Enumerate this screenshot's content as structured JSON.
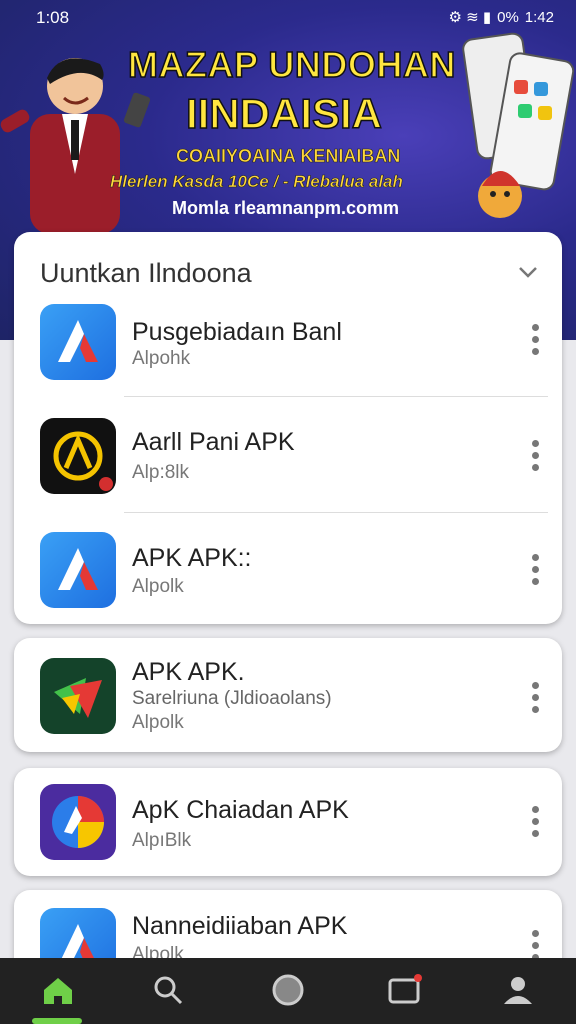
{
  "status_bar": {
    "time": "1:08",
    "right": "1:42",
    "battery": "0%"
  },
  "banner": {
    "title_line1": "MAZAP UNDOHAN",
    "title_line2": "IINDAISIA",
    "subtitle1": "COAIIYOAINA KENIAIBAN",
    "subtitle2": "Hlerlen Kasda 10Ce / - RIebalua alah",
    "url": "Momla rleamnanpm.comm"
  },
  "section": {
    "title": "Uuntkan Ilndoona"
  },
  "apps": [
    {
      "name": "Pusgebiadaın Banl",
      "developer": "Alpohk",
      "description": ""
    },
    {
      "name": "Aarll Pani APK",
      "developer": "Alp:8lk",
      "description": ""
    },
    {
      "name": "APK APK::",
      "developer": "Alpolk",
      "description": ""
    },
    {
      "name": "APK APK.",
      "developer": "Alpolk",
      "description": "Sarelriuna (Jldioaolans)"
    },
    {
      "name": "ApK Chaiadan APK",
      "developer": "AlpıBlk",
      "description": ""
    },
    {
      "name": "Nanneidiiaban APK",
      "developer": "Alpolk",
      "description": ""
    }
  ],
  "colors": {
    "accent": "#6fcf48",
    "nav_bg": "#222222",
    "banner_bg": "#2b2a8c",
    "title_yellow": "#ffe640"
  },
  "nav": [
    "home-icon",
    "search-icon",
    "circle-icon",
    "tv-icon",
    "profile-icon"
  ]
}
